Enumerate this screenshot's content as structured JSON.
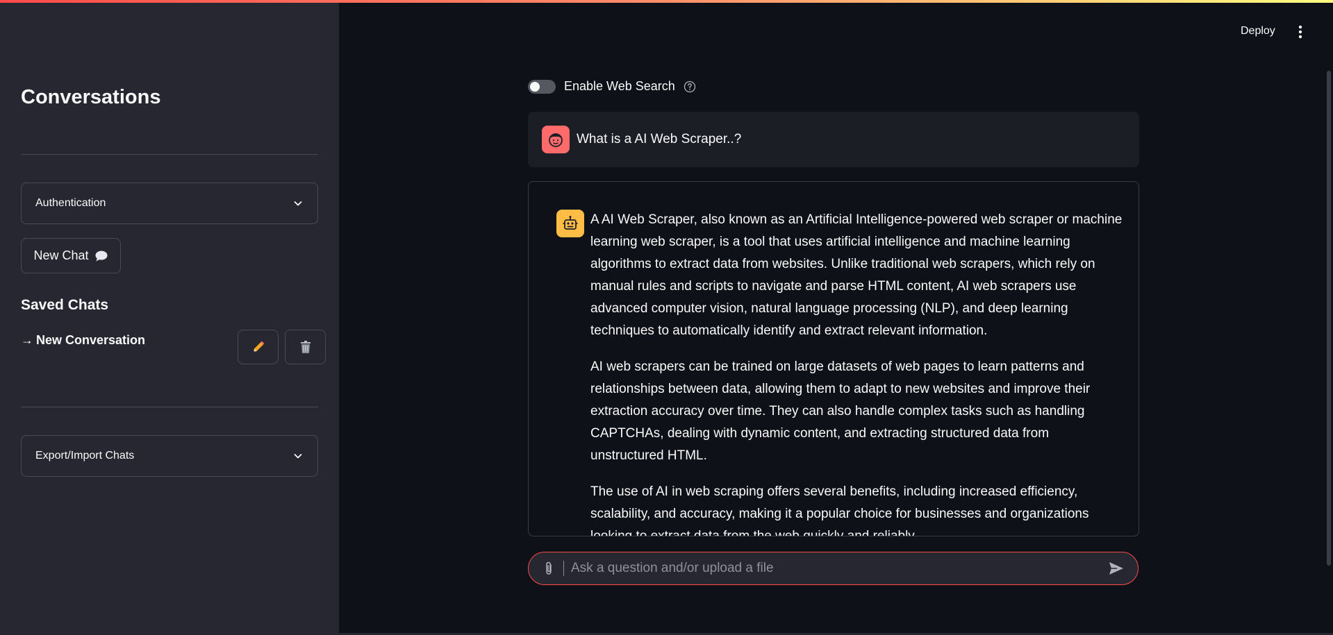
{
  "header": {
    "deploy_label": "Deploy"
  },
  "sidebar": {
    "title": "Conversations",
    "auth_expander_label": "Authentication",
    "new_chat_label": "New Chat",
    "new_chat_icon": "speech-bubble-icon",
    "saved_chats_title": "Saved Chats",
    "conversations": [
      {
        "label": "New Conversation",
        "prefix": "→",
        "active": true
      }
    ],
    "export_expander_label": "Export/Import Chats"
  },
  "main": {
    "web_search_label": "Enable Web Search",
    "web_search_enabled": false,
    "user_message": "What is a AI Web Scraper..?",
    "assistant_paragraphs": [
      "A AI Web Scraper, also known as an Artificial Intelligence-powered web scraper or machine learning web scraper, is a tool that uses artificial intelligence and machine learning algorithms to extract data from websites. Unlike traditional web scrapers, which rely on manual rules and scripts to navigate and parse HTML content, AI web scrapers use advanced computer vision, natural language processing (NLP), and deep learning techniques to automatically identify and extract relevant information.",
      "AI web scrapers can be trained on large datasets of web pages to learn patterns and relationships between data, allowing them to adapt to new websites and improve their extraction accuracy over time. They can also handle complex tasks such as handling CAPTCHAs, dealing with dynamic content, and extracting structured data from unstructured HTML.",
      "The use of AI in web scraping offers several benefits, including increased efficiency, scalability, and accuracy, making it a popular choice for businesses and organizations looking to extract data from the web quickly and reliably."
    ],
    "chat_input_placeholder": "Ask a question and/or upload a file"
  },
  "colors": {
    "accent": "#ff4b4b",
    "user_avatar": "#ff6b6b",
    "assistant_avatar": "#ffbd45",
    "sidebar_bg": "#262730",
    "main_bg": "#0e1117"
  }
}
